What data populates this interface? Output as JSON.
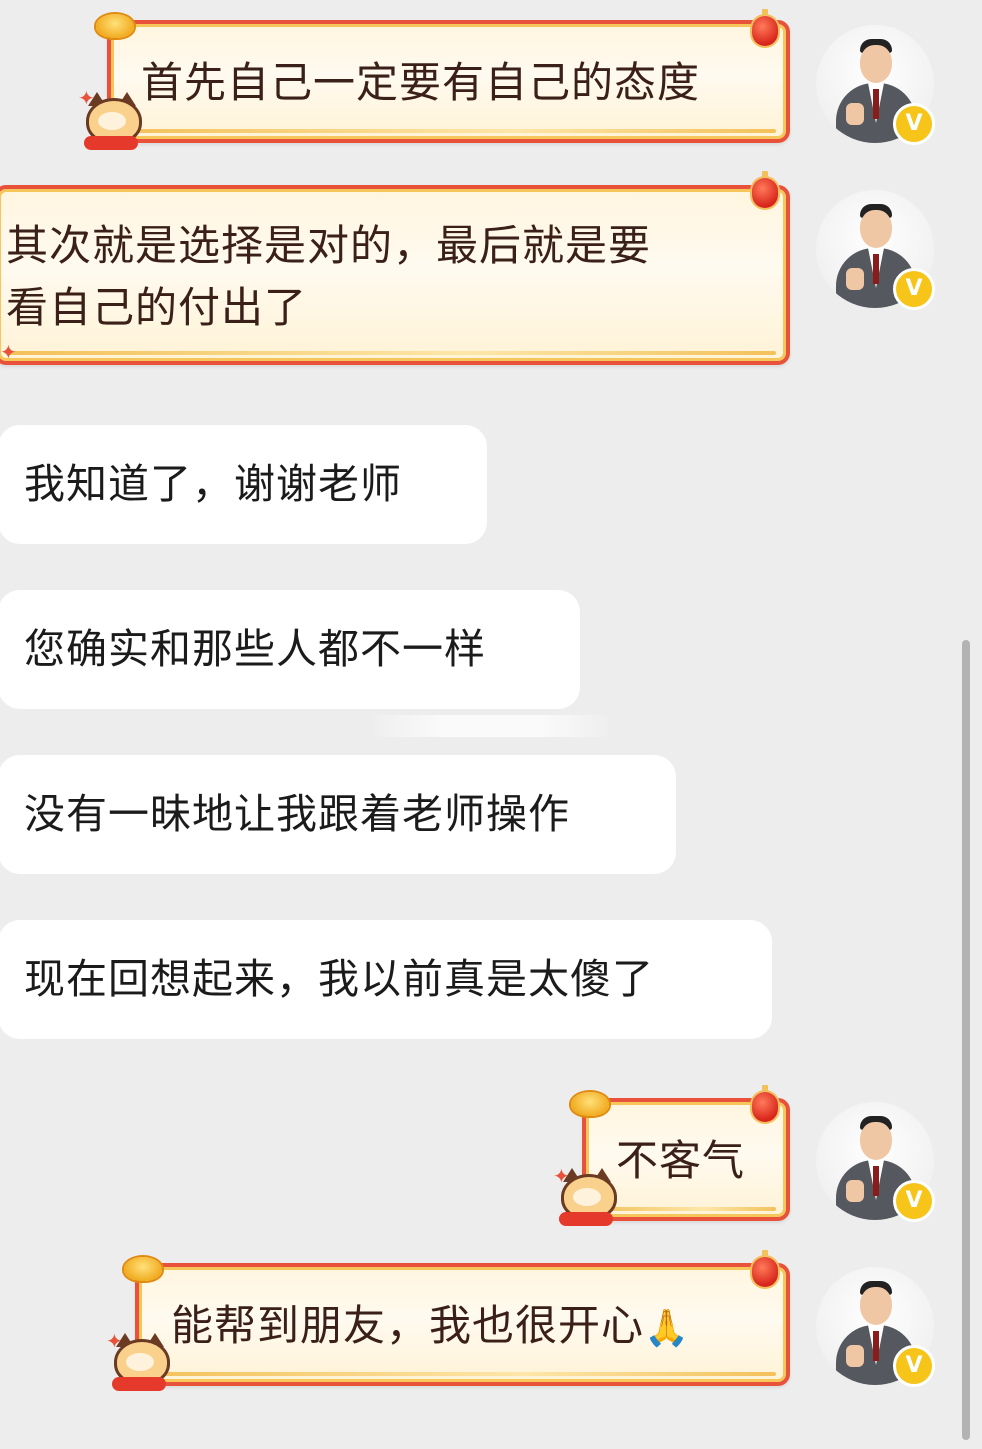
{
  "messages": {
    "m1": {
      "text": "首先自己一定要有自己的态度"
    },
    "m2": {
      "line1": "其次就是选择是对的，最后就是要",
      "line2": "看自己的付出了"
    },
    "m3": {
      "text": "我知道了，谢谢老师"
    },
    "m4": {
      "text": "您确实和那些人都不一样"
    },
    "m5": {
      "text": "没有一昧地让我跟着老师操作"
    },
    "m6": {
      "text": "现在回想起来，我以前真是太傻了"
    },
    "m7": {
      "text": "不客气"
    },
    "m8": {
      "text": "能帮到朋友，我也很开心",
      "emoji": "🙏"
    }
  },
  "badge": {
    "label": "V"
  },
  "colors": {
    "background": "#ededed",
    "bubble_border": "#e8523a",
    "bubble_fill": "#fff6df",
    "badge": "#f7c51a"
  },
  "icons": {
    "avatar": "teacher-avatar-icon",
    "badge": "verified-v-badge-icon",
    "lantern": "red-lantern-icon",
    "ingot": "gold-ingot-icon",
    "cat": "cartoon-cat-icon"
  }
}
